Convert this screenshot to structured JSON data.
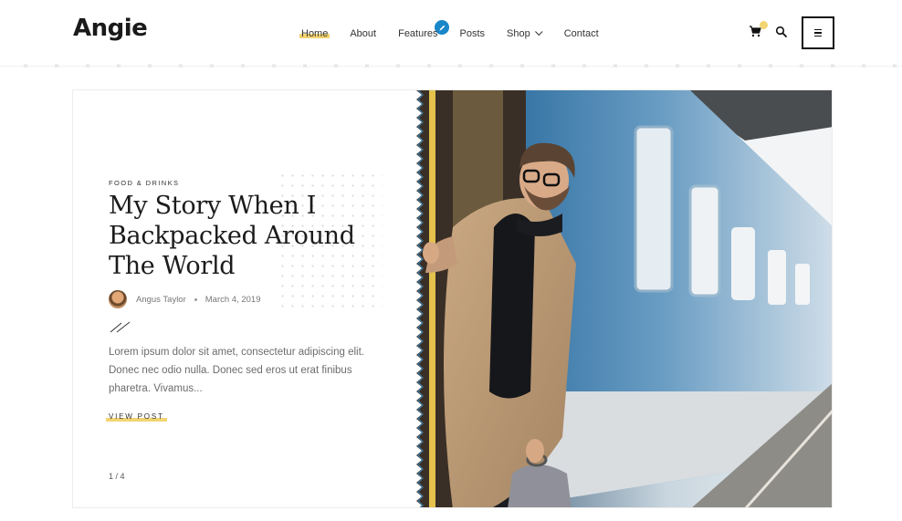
{
  "header": {
    "logo": "Angie",
    "nav": [
      {
        "label": "Home",
        "active": true
      },
      {
        "label": "About"
      },
      {
        "label": "Features"
      },
      {
        "label": "Posts"
      },
      {
        "label": "Shop",
        "has_dropdown": true
      },
      {
        "label": "Contact"
      }
    ],
    "icons": [
      "cart-icon",
      "search-icon",
      "menu-icon",
      "edit-pencil-icon"
    ],
    "accent_color": "#f2d472",
    "badge_color": "#1a87c9"
  },
  "slide": {
    "category": "FOOD & DRINKS",
    "title": "My Story When I Backpacked Around The World",
    "author": "Angus Taylor",
    "date": "March 4, 2019",
    "excerpt": "Lorem ipsum dolor sit amet, consectetur adipiscing elit. Donec nec odio nulla. Donec sed eros ut erat finibus pharetra. Vivamus...",
    "cta": "VIEW POST",
    "counter": "1 / 4"
  }
}
